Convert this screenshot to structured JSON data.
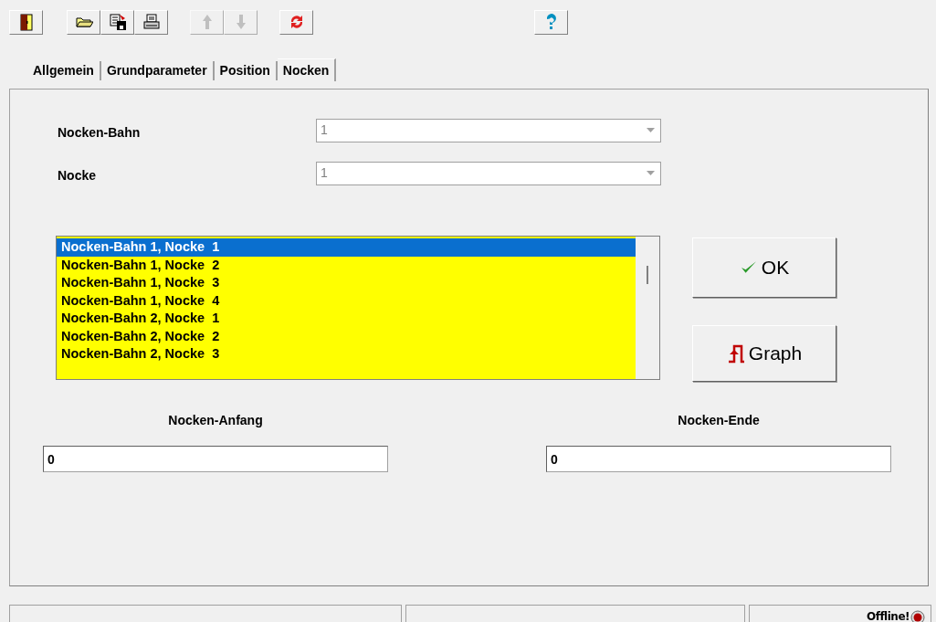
{
  "toolbar": [
    {
      "kind": "exit",
      "disabled": false
    },
    {
      "kind": "open",
      "disabled": false
    },
    {
      "kind": "save",
      "disabled": false
    },
    {
      "kind": "print",
      "disabled": false
    },
    {
      "kind": "up",
      "disabled": true
    },
    {
      "kind": "down",
      "disabled": true
    },
    {
      "kind": "refresh",
      "disabled": false
    },
    {
      "kind": "help",
      "disabled": false
    }
  ],
  "tabs": [
    {
      "label": "Allgemein",
      "selected": false
    },
    {
      "label": "Grundparameter",
      "selected": false
    },
    {
      "label": "Position",
      "selected": false
    },
    {
      "label": "Nocken",
      "selected": true
    }
  ],
  "selectors": [
    {
      "label": "Nocken-Bahn",
      "value": "1",
      "disabled": true
    },
    {
      "label": "Nocke",
      "value": "1",
      "disabled": true
    }
  ],
  "list": {
    "items": [
      {
        "label": "Nocken-Bahn 1, Nocke  1",
        "selected": true
      },
      {
        "label": "Nocken-Bahn 1, Nocke  2",
        "selected": false
      },
      {
        "label": "Nocken-Bahn 1, Nocke  3",
        "selected": false
      },
      {
        "label": "Nocken-Bahn 1, Nocke  4",
        "selected": false
      },
      {
        "label": "Nocken-Bahn 2, Nocke  1",
        "selected": false
      },
      {
        "label": "Nocken-Bahn 2, Nocke  2",
        "selected": false
      },
      {
        "label": "Nocken-Bahn 2, Nocke  3",
        "selected": false
      }
    ]
  },
  "buttons": [
    {
      "kind": "ok",
      "label": "OK"
    },
    {
      "kind": "graph",
      "label": "Graph"
    }
  ],
  "fields": [
    {
      "label": "Nocken-Anfang",
      "value": "0"
    },
    {
      "label": "Nocken-Ende",
      "value": "0"
    }
  ],
  "status_bar": {
    "status": "Offline!"
  }
}
